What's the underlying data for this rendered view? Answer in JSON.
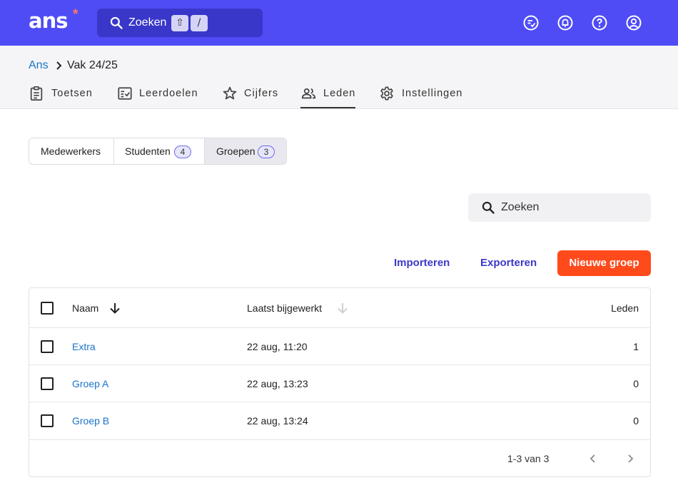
{
  "app": {
    "logo_text": "ans",
    "logo_mark": "*",
    "search": {
      "label": "Zoeken",
      "kbd_shift": "⇧",
      "kbd_slash": "/"
    },
    "icons": [
      "checklist-icon",
      "bell-icon",
      "help-icon",
      "account-icon"
    ],
    "accent": "#4f4cf6"
  },
  "breadcrumb": {
    "root": "Ans",
    "current": "Vak 24/25"
  },
  "tabs": [
    {
      "label": "Toetsen",
      "icon": "clipboard-icon"
    },
    {
      "label": "Leerdoelen",
      "icon": "checklist-box-icon"
    },
    {
      "label": "Cijfers",
      "icon": "star-icon"
    },
    {
      "label": "Leden",
      "icon": "people-icon",
      "active": true
    },
    {
      "label": "Instellingen",
      "icon": "gear-icon"
    }
  ],
  "segments": [
    {
      "label": "Medewerkers"
    },
    {
      "label": "Studenten",
      "count": "4"
    },
    {
      "label": "Groepen",
      "count": "3",
      "selected": true
    }
  ],
  "search": {
    "placeholder": "Zoeken"
  },
  "actions": {
    "import": "Importeren",
    "export": "Exporteren",
    "new_group": "Nieuwe groep",
    "primary_color": "#ff4a1c"
  },
  "table": {
    "headers": {
      "name": "Naam",
      "updated": "Laatst bijgewerkt",
      "members": "Leden"
    },
    "rows": [
      {
        "name": "Extra",
        "updated": "22 aug, 11:20",
        "members": "1"
      },
      {
        "name": "Groep A",
        "updated": "22 aug, 13:23",
        "members": "0"
      },
      {
        "name": "Groep B",
        "updated": "22 aug, 13:24",
        "members": "0"
      }
    ],
    "pagination": "1-3 van 3"
  }
}
